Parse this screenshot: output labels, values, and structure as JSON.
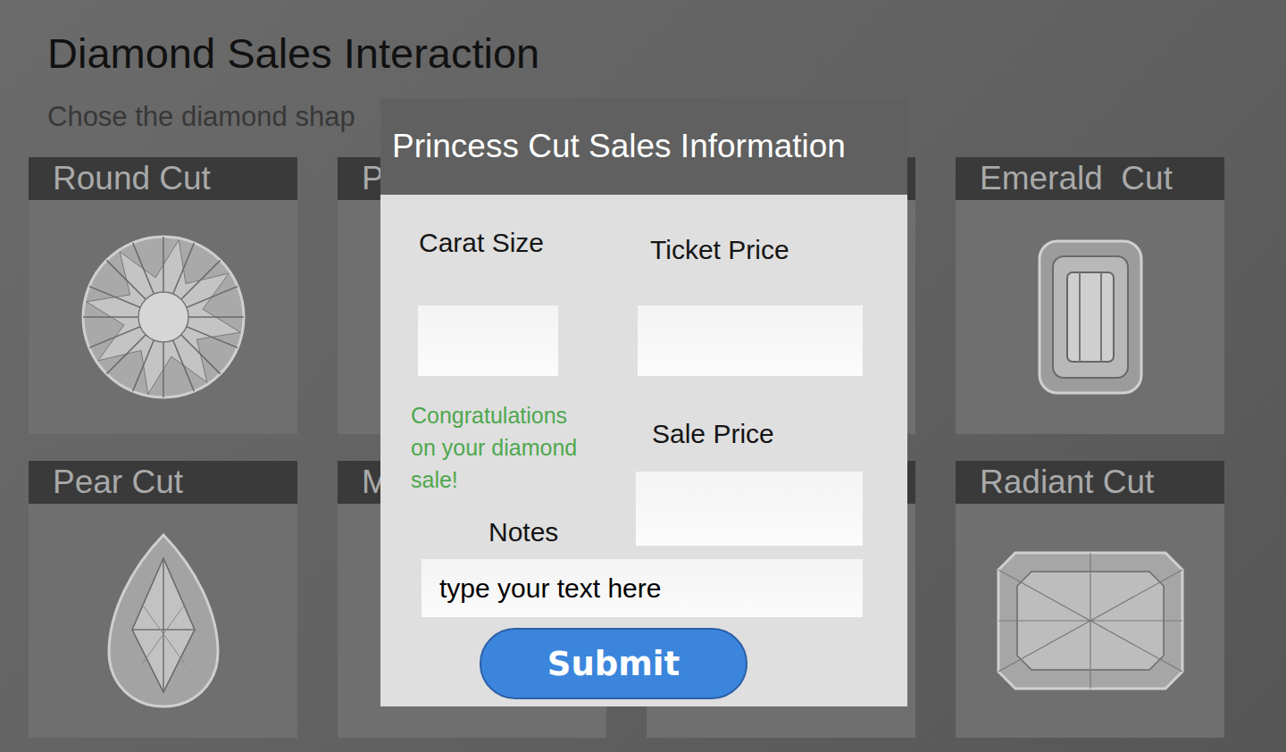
{
  "page": {
    "title": "Diamond Sales Interaction",
    "subtitle": "Chose the diamond shap"
  },
  "cards": [
    {
      "label": "Round Cut"
    },
    {
      "label": "P"
    },
    {
      "label": ""
    },
    {
      "label": "Emerald  Cut"
    },
    {
      "label": "Pear Cut"
    },
    {
      "label": "M"
    },
    {
      "label": ""
    },
    {
      "label": "Radiant Cut"
    }
  ],
  "modal": {
    "title": "Princess Cut Sales Information",
    "carat": {
      "label": "Carat Size"
    },
    "ticket": {
      "label": "Ticket Price"
    },
    "sale": {
      "label": "Sale Price"
    },
    "message": "Congratulations on your diamond sale!",
    "notes": {
      "label": "Notes",
      "value": "type your text here"
    },
    "submit": "Submit"
  }
}
